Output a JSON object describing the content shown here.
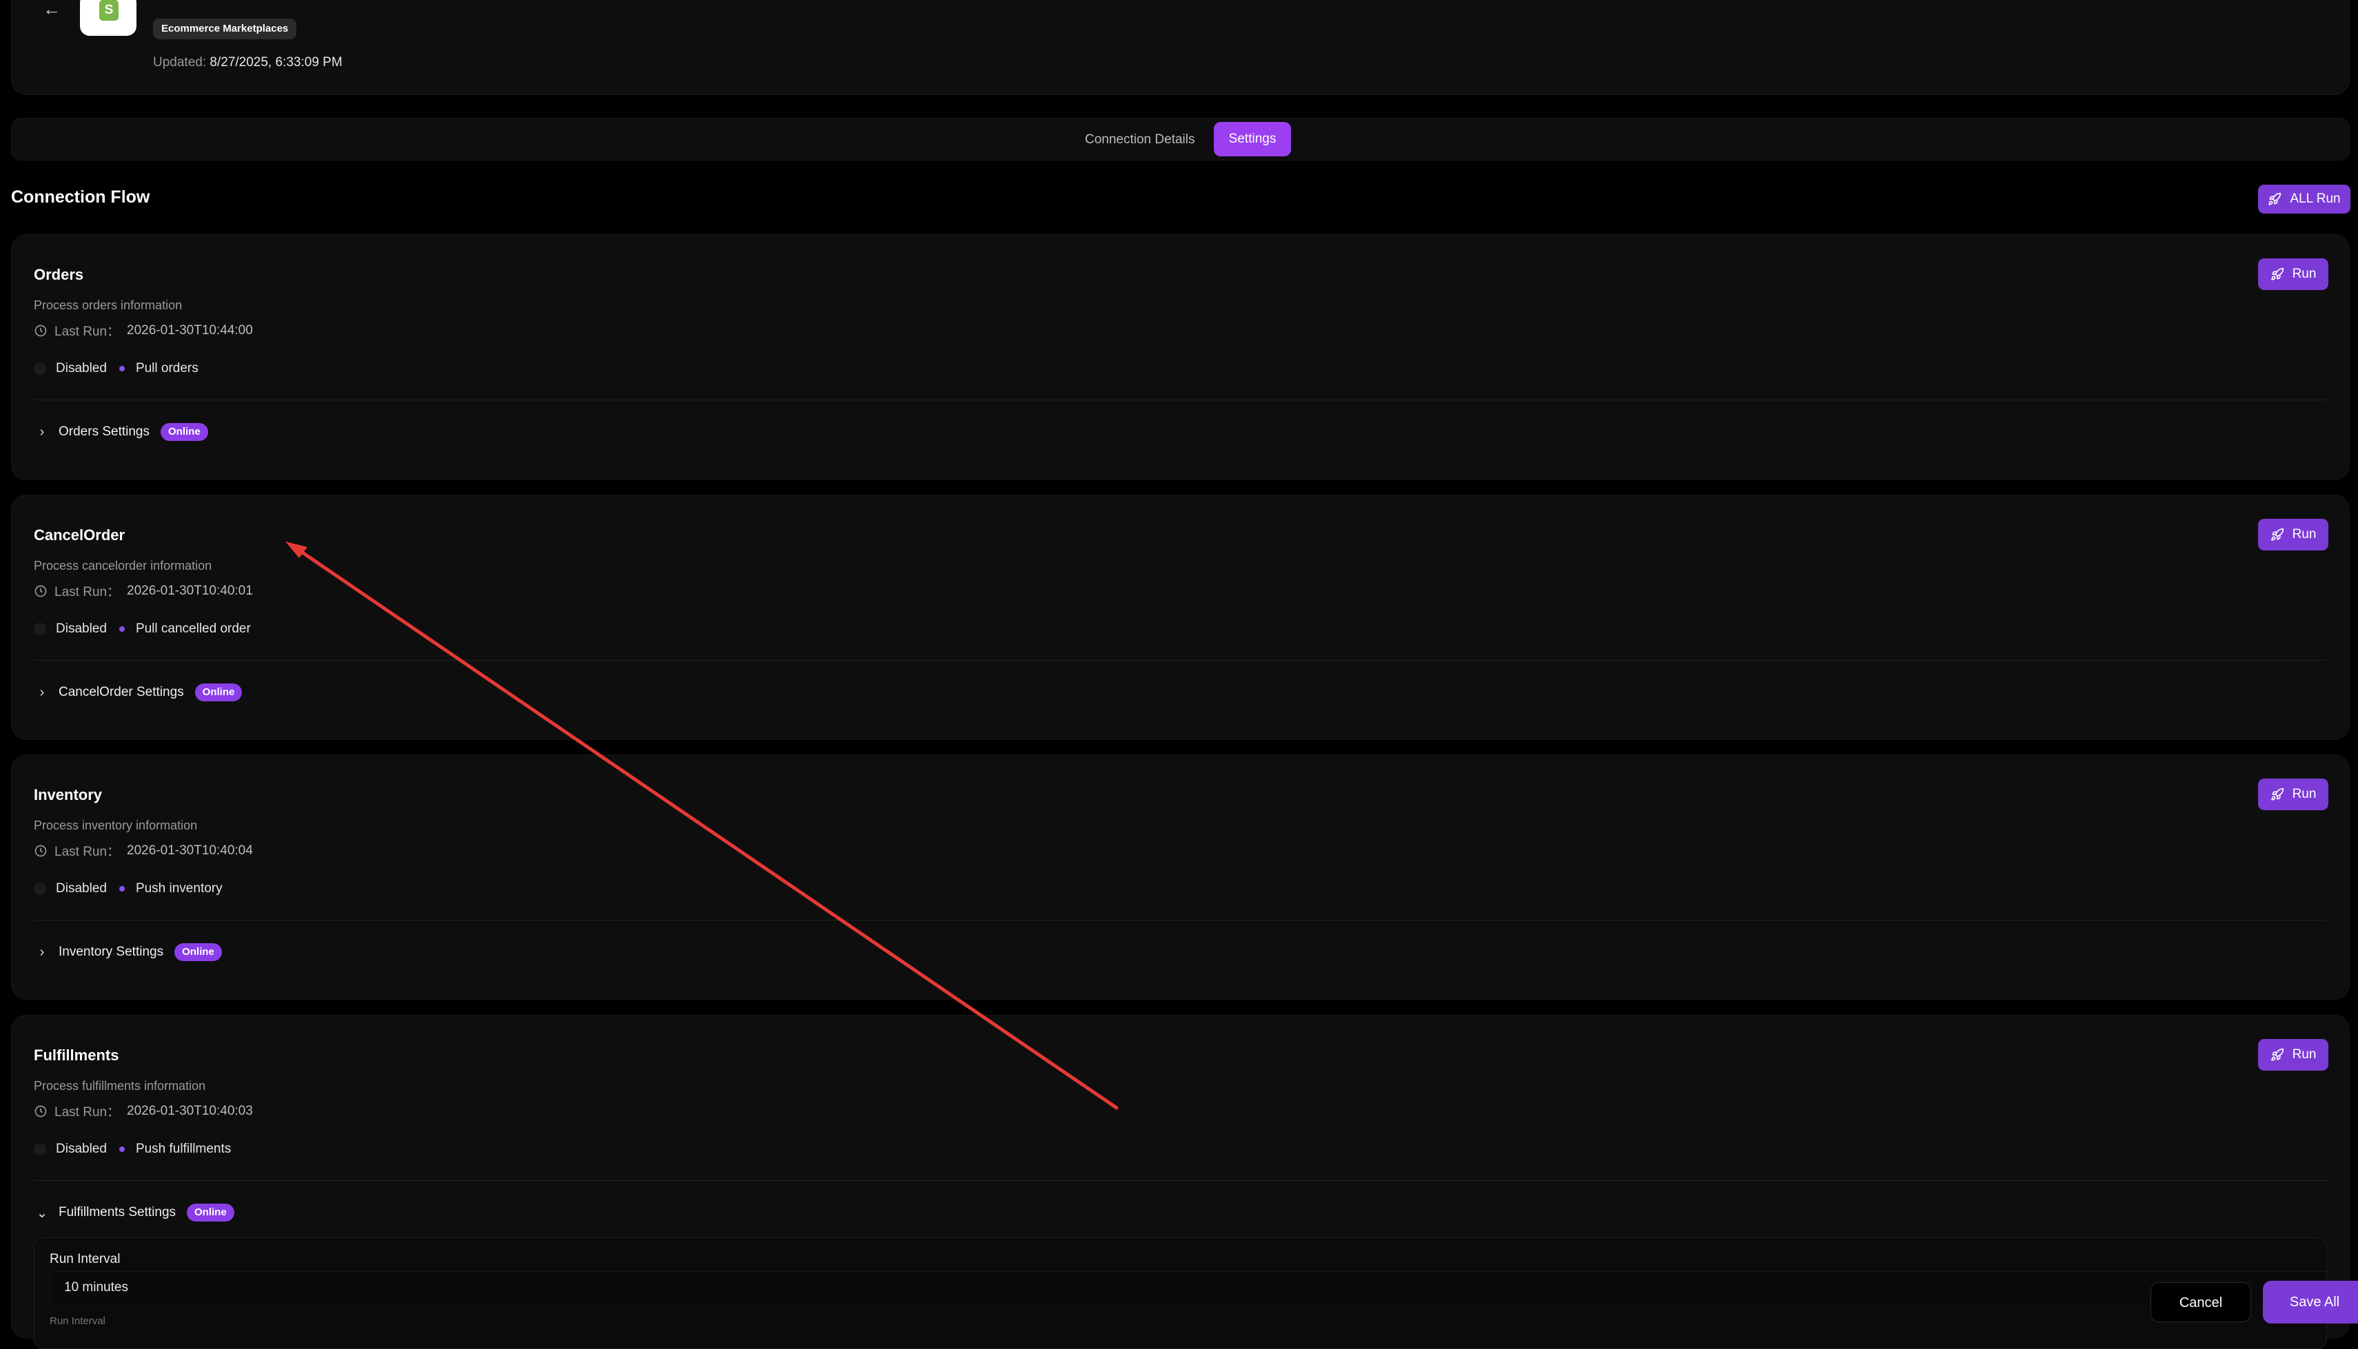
{
  "header": {
    "back_icon": "arrow-left-icon",
    "logo_icon": "shopify-bag-icon",
    "logo_letter": "S",
    "category_tag": "Ecommerce Marketplaces",
    "updated_label": "Updated:",
    "updated_value": "8/27/2025, 6:33:09 PM"
  },
  "tabs": [
    {
      "label": "Connection Details",
      "active": false
    },
    {
      "label": "Settings",
      "active": true
    }
  ],
  "flow": {
    "title": "Connection Flow",
    "all_run_label": "ALL Run"
  },
  "cards": [
    {
      "title": "Orders",
      "description": "Process orders information",
      "last_run_label": "Last Run：",
      "last_run": "2026-01-30T10:44:00",
      "toggle_label": "Disabled",
      "action": "Pull orders",
      "settings_label": "Orders Settings",
      "status": "Online",
      "run_label": "Run"
    },
    {
      "title": "CancelOrder",
      "description": "Process cancelorder information",
      "last_run_label": "Last Run：",
      "last_run": "2026-01-30T10:40:01",
      "toggle_label": "Disabled",
      "action": "Pull cancelled order",
      "settings_label": "CancelOrder Settings",
      "status": "Online",
      "run_label": "Run"
    },
    {
      "title": "Inventory",
      "description": "Process inventory information",
      "last_run_label": "Last Run：",
      "last_run": "2026-01-30T10:40:04",
      "toggle_label": "Disabled",
      "action": "Push inventory",
      "settings_label": "Inventory Settings",
      "status": "Online",
      "run_label": "Run"
    },
    {
      "title": "Fulfillments",
      "description": "Process fulfillments information",
      "last_run_label": "Last Run：",
      "last_run": "2026-01-30T10:40:03",
      "toggle_label": "Disabled",
      "action": "Push fulfillments",
      "settings_label": "Fulfillments Settings",
      "status": "Online",
      "run_label": "Run"
    }
  ],
  "fulfillments_settings": {
    "field_label": "Run Interval",
    "field_value": "10 minutes",
    "helper_label": "Run Interval"
  },
  "footer": {
    "cancel_label": "Cancel",
    "save_label": "Save All"
  },
  "colors": {
    "accent": "#7c3bd6",
    "active_tab": "#9b3ff0",
    "annotation_arrow": "#e53935"
  }
}
